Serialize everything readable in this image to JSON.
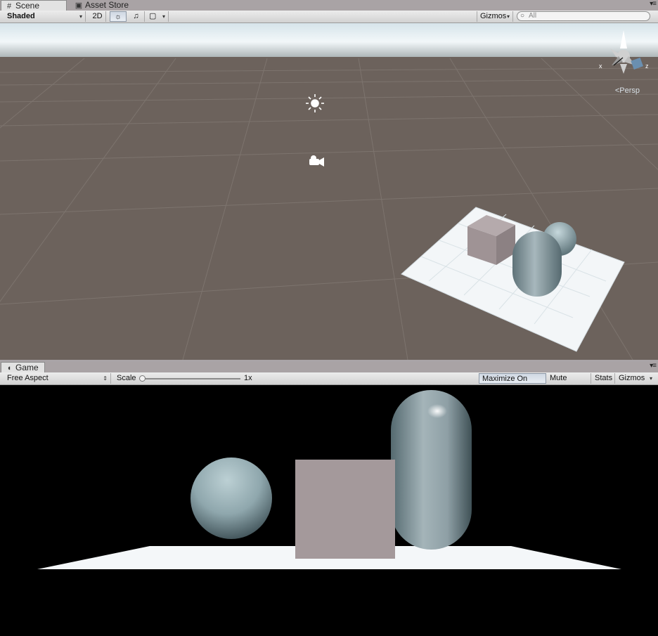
{
  "scene_tabs": [
    {
      "label": "Scene",
      "icon": "hash-grid-icon",
      "active": true
    },
    {
      "label": "Asset Store",
      "icon": "shopping-bag-icon",
      "active": false
    }
  ],
  "scene_toolbar": {
    "draw_mode": "Shaded",
    "mode_2d": "2D",
    "lighting_icon": "sun-icon",
    "audio_icon": "speaker-icon",
    "effects_icon": "image-icon",
    "gizmos": "Gizmos",
    "search_placeholder": "All"
  },
  "scene_view": {
    "projection_label": "Persp",
    "axis_x": "x",
    "axis_z": "z",
    "ground_color": "#6c625c",
    "sky_color": "#e8f1f4"
  },
  "game_tabs": [
    {
      "label": "Game",
      "icon": "pacman-icon",
      "active": true
    }
  ],
  "game_toolbar": {
    "aspect": "Free Aspect",
    "scale_label": "Scale",
    "scale_value": "1x",
    "scale_fraction": 0.0,
    "maximize_on_play": "Maximize On Play",
    "mute_audio": "Mute Audio",
    "stats": "Stats",
    "gizmos": "Gizmos"
  },
  "colors": {
    "cube": "#a4999b",
    "sphere": "#8fa7ad",
    "capsule": "#9aaab0",
    "plane": "#f4f7f9",
    "game_background": "#000000"
  }
}
